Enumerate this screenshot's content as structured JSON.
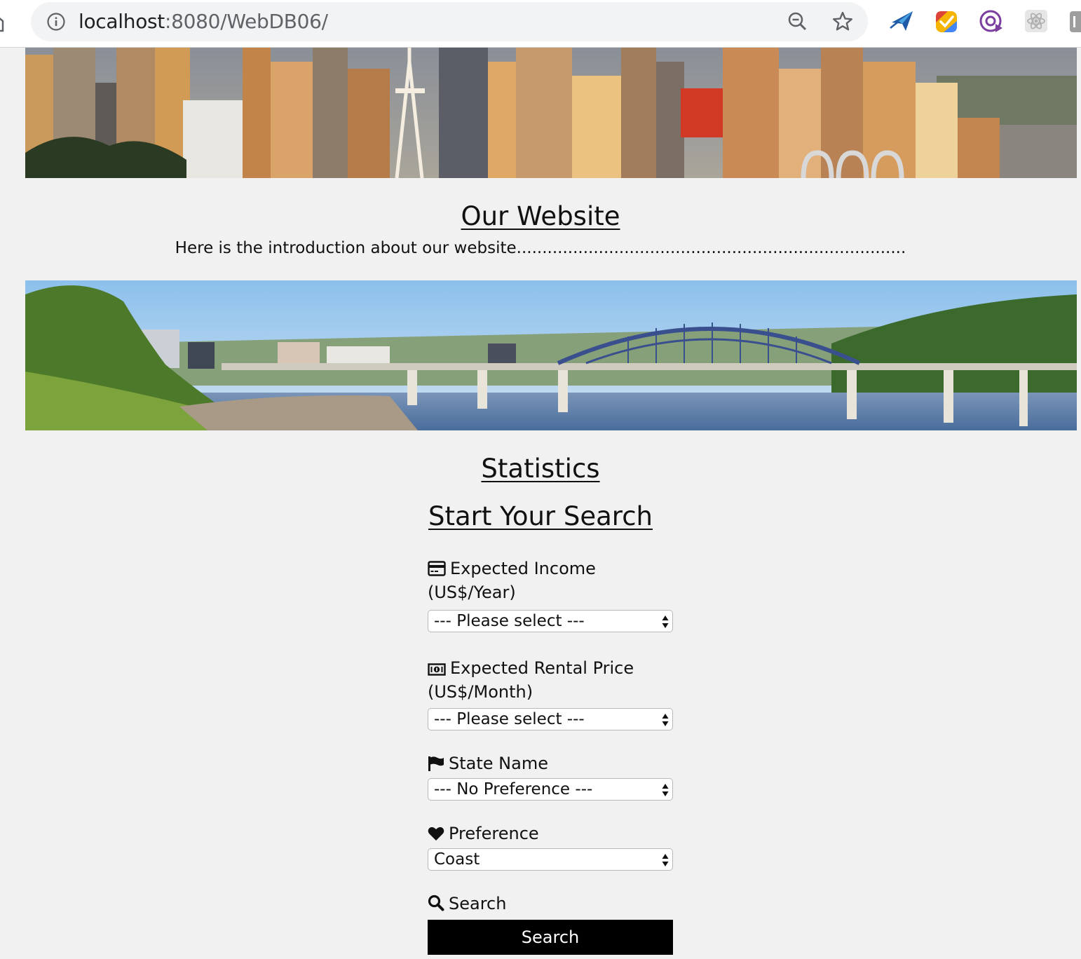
{
  "browser": {
    "url_host": "localhost",
    "url_path": ":8080/WebDB06/"
  },
  "intro": {
    "title": "Our Website",
    "text": "Here is the introduction about our website............................................................................"
  },
  "statistics": {
    "title": "Statistics"
  },
  "search": {
    "title": "Start Your Search",
    "fields": [
      {
        "label_line1": "Expected Income",
        "label_line2": "(US$/Year)",
        "icon": "credit-card-icon",
        "value": "--- Please select ---"
      },
      {
        "label_line1": "Expected Rental Price",
        "label_line2": "(US$/Month)",
        "icon": "money-bill-icon",
        "value": "--- Please select ---"
      },
      {
        "label_line1": "State Name",
        "icon": "flag-icon",
        "value": "--- No Preference ---"
      },
      {
        "label_line1": "Preference",
        "icon": "heart-icon",
        "value": "Coast"
      }
    ],
    "search_label": "Search",
    "search_button": "Search"
  },
  "colors": {
    "page_bg": "#f1f1f1",
    "button_bg": "#000000",
    "button_text": "#ffffff"
  }
}
